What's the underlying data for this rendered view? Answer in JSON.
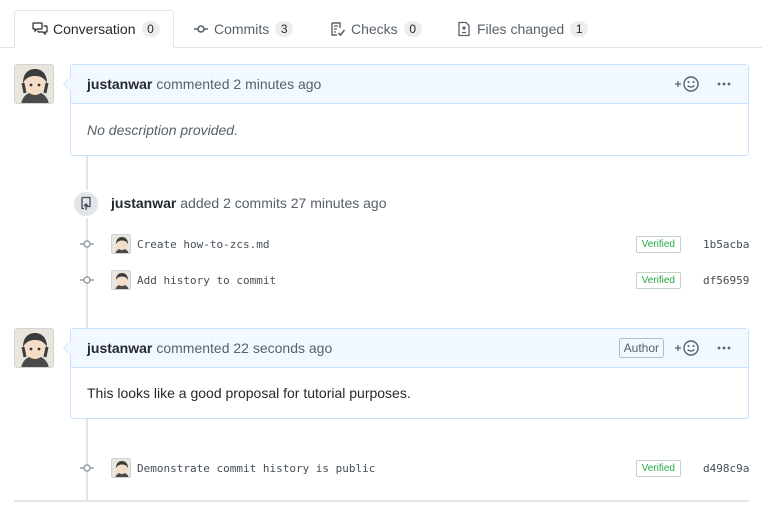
{
  "tabs": [
    {
      "label": "Conversation",
      "count": "0",
      "icon": "comment-discussion-icon",
      "selected": true
    },
    {
      "label": "Commits",
      "count": "3",
      "icon": "git-commit-icon",
      "selected": false
    },
    {
      "label": "Checks",
      "count": "0",
      "icon": "checklist-icon",
      "selected": false
    },
    {
      "label": "Files changed",
      "count": "1",
      "icon": "file-diff-icon",
      "selected": false
    }
  ],
  "comment1": {
    "author": "justanwar",
    "action": "commented 2 minutes ago",
    "body": "No description provided."
  },
  "commit_event": {
    "author": "justanwar",
    "text": "added 2 commits 27 minutes ago"
  },
  "commits": [
    {
      "message": "Create how-to-zcs.md",
      "verified": "Verified",
      "sha": "1b5acba"
    },
    {
      "message": "Add history to commit",
      "verified": "Verified",
      "sha": "df56959"
    },
    {
      "message": "Demonstrate commit history is public",
      "verified": "Verified",
      "sha": "d498c9a"
    }
  ],
  "comment2": {
    "author": "justanwar",
    "action": "commented 22 seconds ago",
    "author_label": "Author",
    "body": "This looks like a good proposal for tutorial purposes."
  },
  "colors": {
    "comment_border": "#c8e1ff",
    "comment_header_bg": "#f1f8ff",
    "verified_green": "#28a745",
    "text_muted": "#586069"
  }
}
